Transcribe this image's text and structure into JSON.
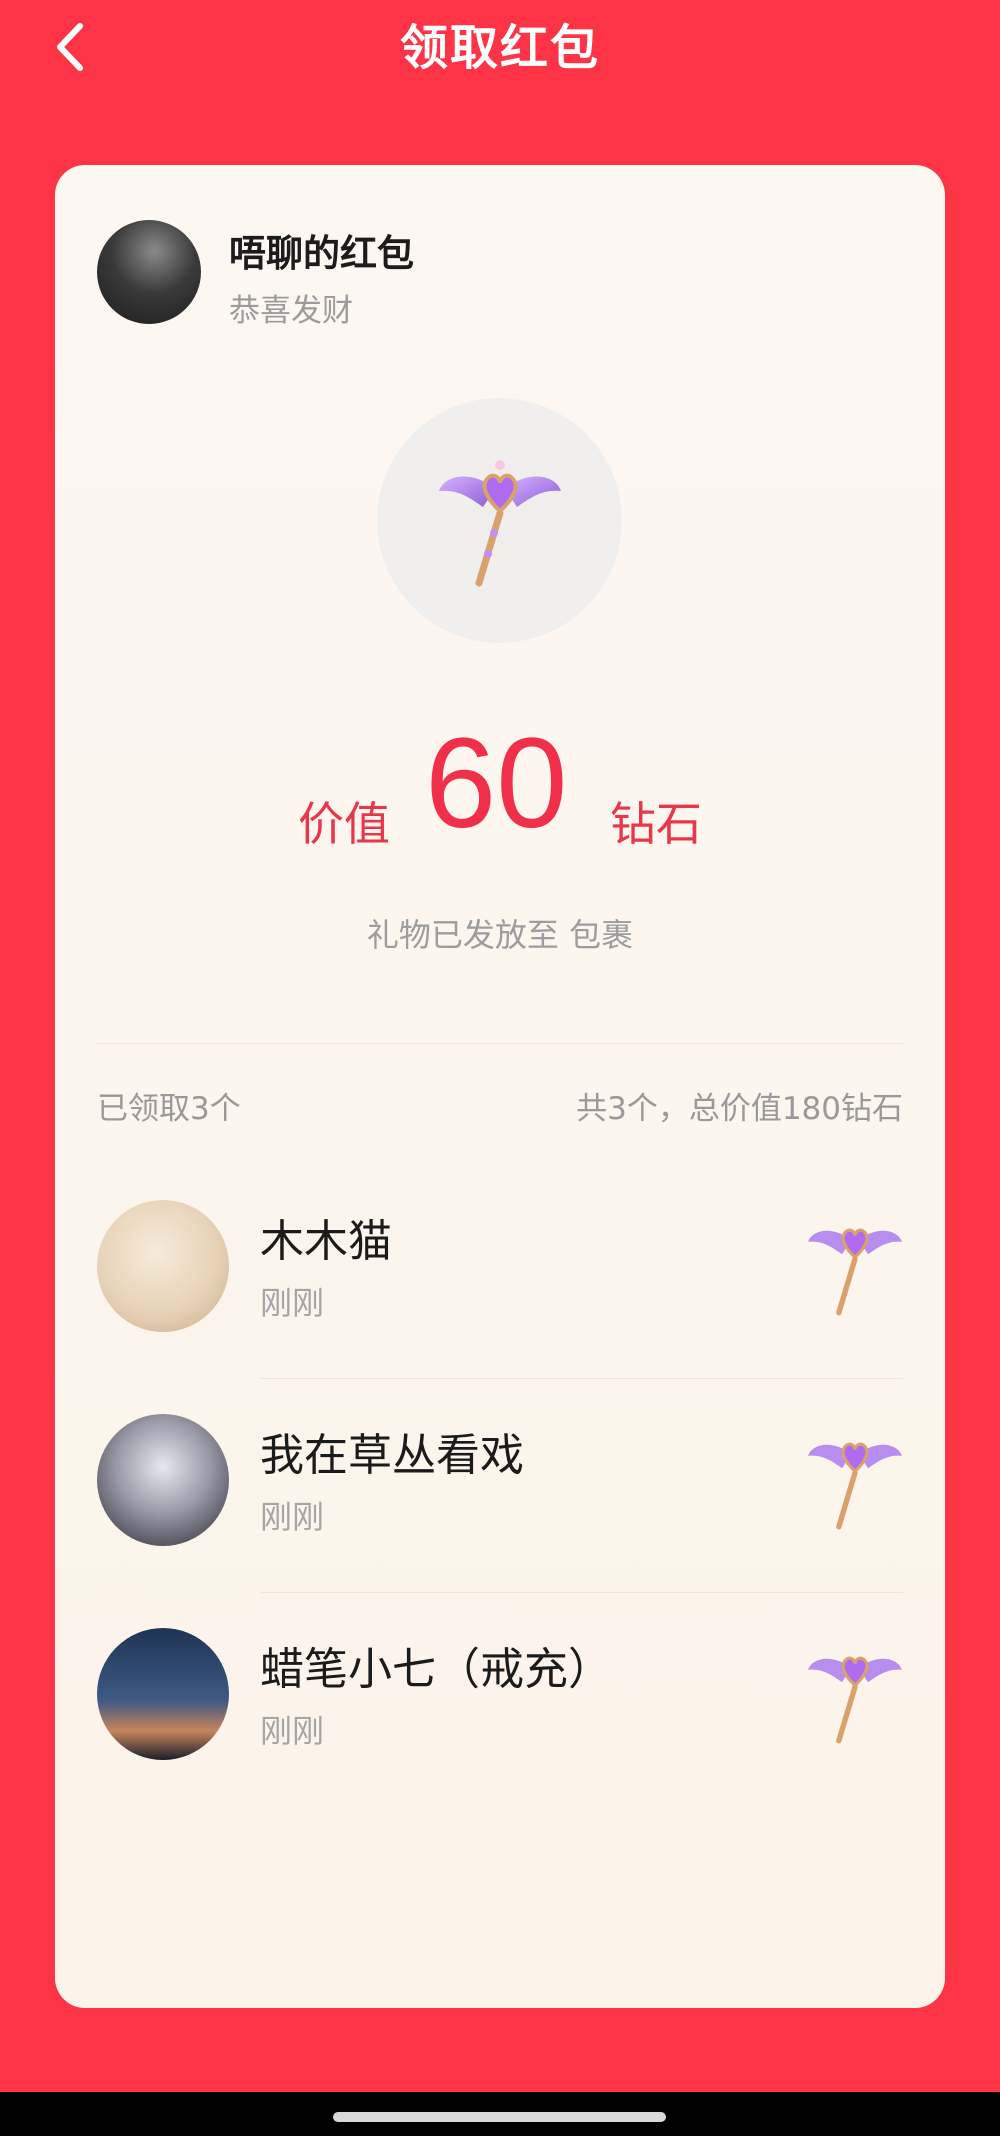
{
  "header": {
    "title": "领取红包"
  },
  "sender": {
    "name": "唔聊的红包",
    "message": "恭喜发财"
  },
  "gift": {
    "icon": "magic-wand-gift-icon",
    "value_prefix": "价值",
    "value": "60",
    "value_suffix": "钻石",
    "status": "礼物已发放至 包裹"
  },
  "summary": {
    "claimed": "已领取3个",
    "total": "共3个，总价值180钻石"
  },
  "claimers": [
    {
      "name": "木木猫",
      "time": "刚刚"
    },
    {
      "name": "我在草丛看戏",
      "time": "刚刚"
    },
    {
      "name": "蜡笔小七（戒充）",
      "time": "刚刚"
    }
  ],
  "colors": {
    "background": "#fd3346",
    "accent": "#f0304a",
    "card": "#fdf7f2"
  }
}
